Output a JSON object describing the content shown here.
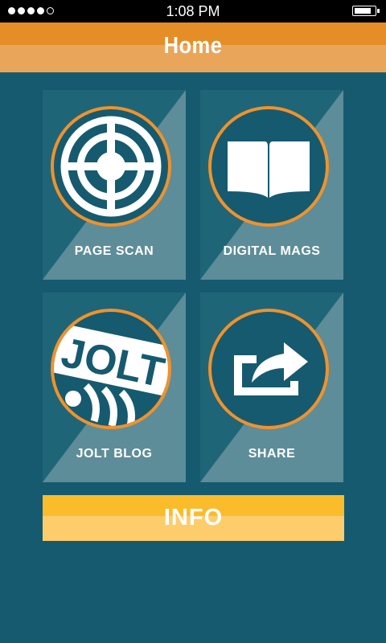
{
  "status_bar": {
    "time": "1:08 PM",
    "signal_bars_filled": 4,
    "signal_bars_total": 5,
    "battery_level": 0.9
  },
  "header": {
    "title": "Home"
  },
  "tiles": [
    {
      "label": "PAGE SCAN",
      "icon": "target-icon"
    },
    {
      "label": "DIGITAL MAGS",
      "icon": "open-book-icon"
    },
    {
      "label": "JOLT BLOG",
      "icon": "jolt-logo-icon",
      "logo_text": "JOLT"
    },
    {
      "label": "SHARE",
      "icon": "share-icon"
    }
  ],
  "info_button": {
    "label": "INFO"
  },
  "colors": {
    "background": "#165a6f",
    "header_orange": "#e58e27",
    "header_orange_light": "#e9a65a",
    "accent_ring": "#f0922c",
    "info_yellow": "#fbbc2c",
    "info_yellow_light": "#fdcd6c",
    "status_bar": "#000000"
  }
}
